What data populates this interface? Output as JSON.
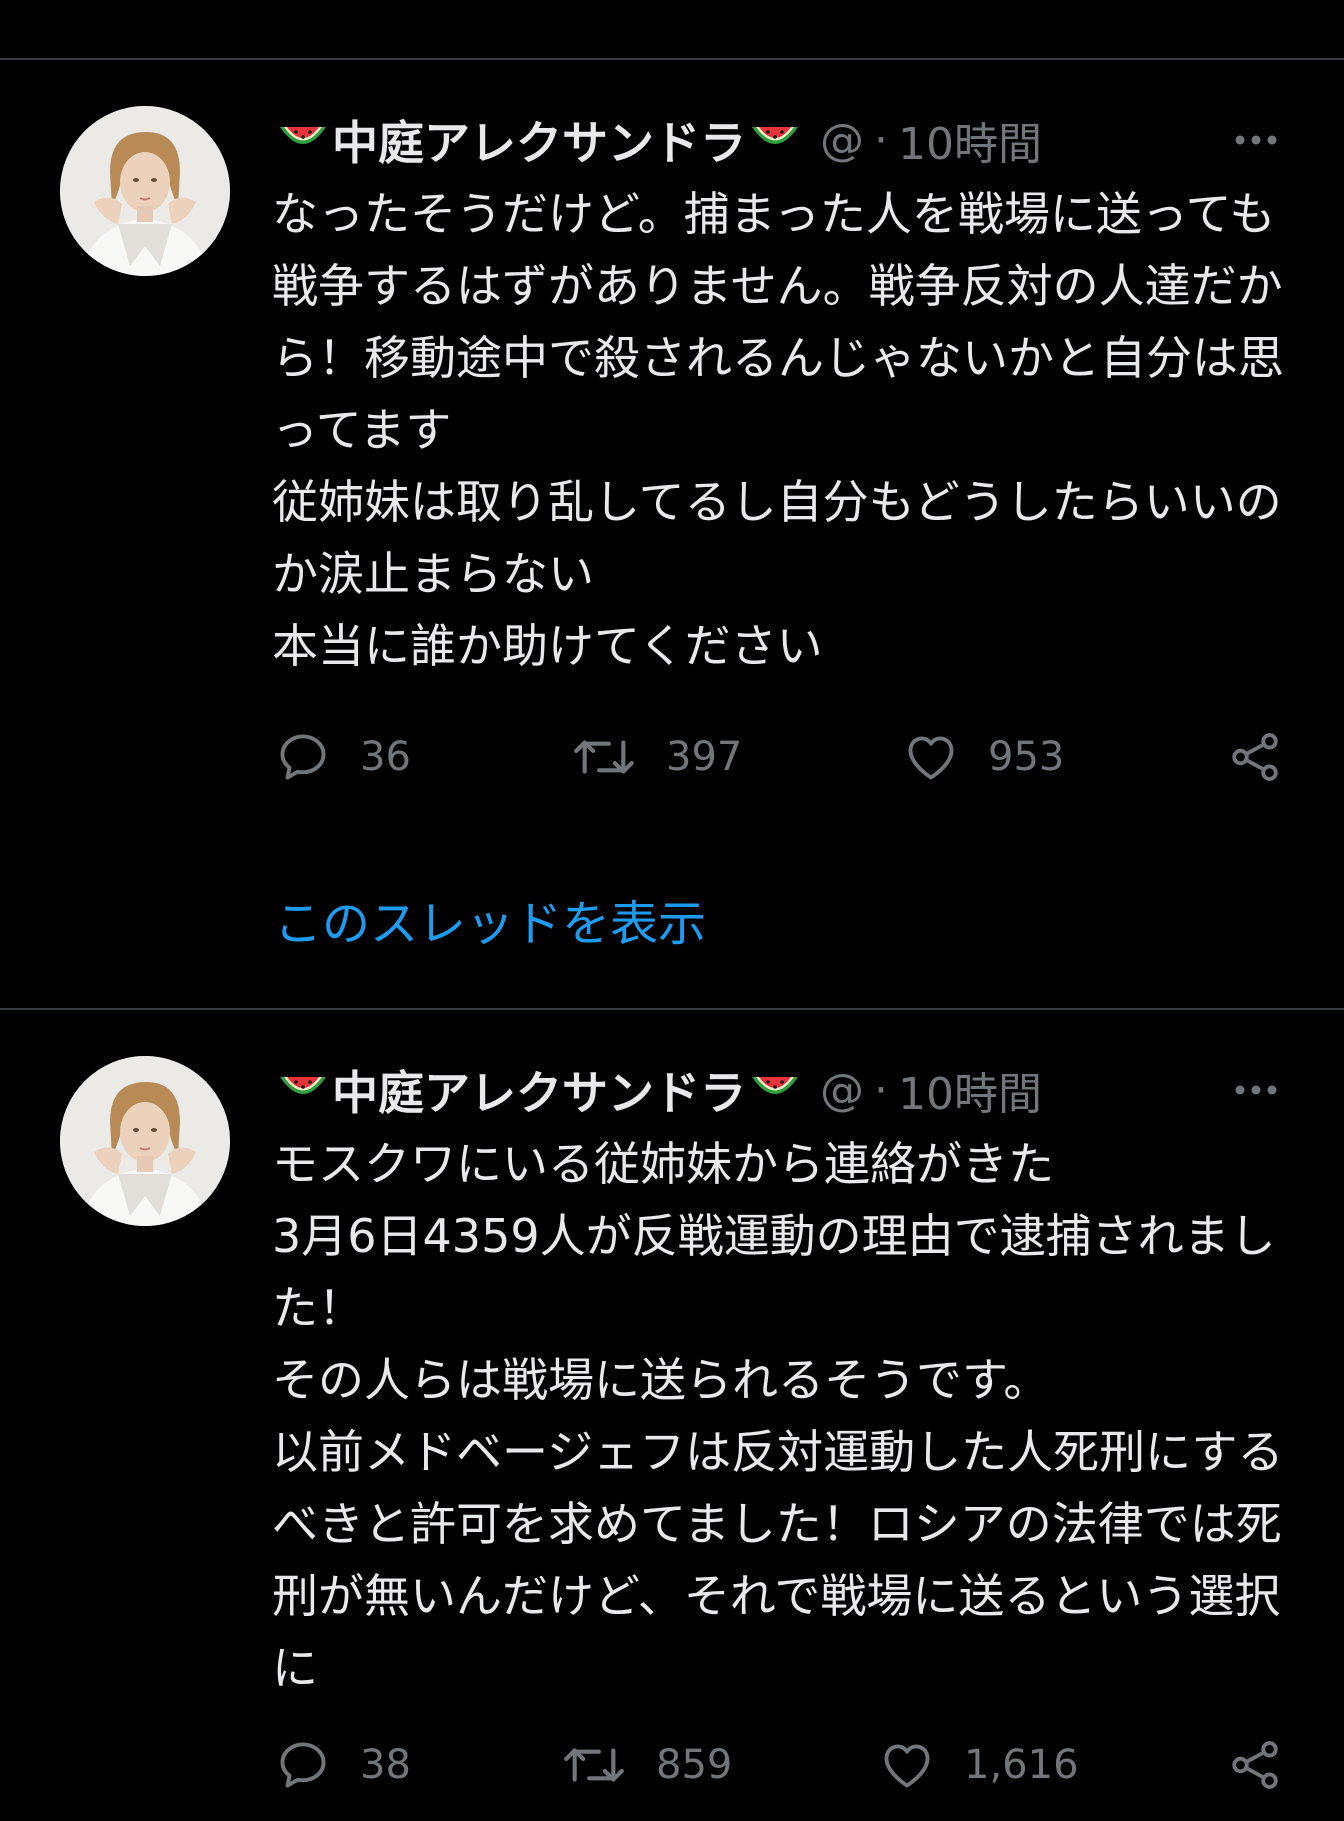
{
  "tweets": [
    {
      "author": {
        "name": "中庭アレクサンドラ",
        "handle": "@",
        "separator": "·",
        "time": "10時間"
      },
      "text": "なったそうだけど。捕まった人を戦場に送っても戦争するはずがありません。戦争反対の人達だから！移動途中で殺されるんじゃないかと自分は思ってます\n従姉妹は取り乱してるし自分もどうしたらいいのか涙止まらない\n本当に誰か助けてください",
      "stats": {
        "replies": "36",
        "retweets": "397",
        "likes": "953"
      },
      "show_thread": "このスレッドを表示"
    },
    {
      "author": {
        "name": "中庭アレクサンドラ",
        "handle": "@",
        "separator": "·",
        "time": "10時間"
      },
      "text": "モスクワにいる従姉妹から連絡がきた\n3月6日4359人が反戦運動の理由で逮捕されました！\nその人らは戦場に送られるそうです。\n以前メドベージェフは反対運動した人死刑にするべきと許可を求めてました！ロシアの法律では死刑が無いんだけど、それで戦場に送るという選択に",
      "stats": {
        "replies": "38",
        "retweets": "859",
        "likes": "1,616"
      }
    }
  ],
  "icons": {
    "reply": "speech-bubble-icon",
    "retweet": "retweet-arrows-icon",
    "like": "heart-icon",
    "share": "share-icon",
    "more": "more-dots-icon",
    "name_emoji": "watermelon-icon"
  },
  "colors": {
    "background": "#000000",
    "text": "#e7e9ea",
    "muted": "#71767b",
    "link": "#1d9bf0",
    "divider": "#3a3d40"
  }
}
